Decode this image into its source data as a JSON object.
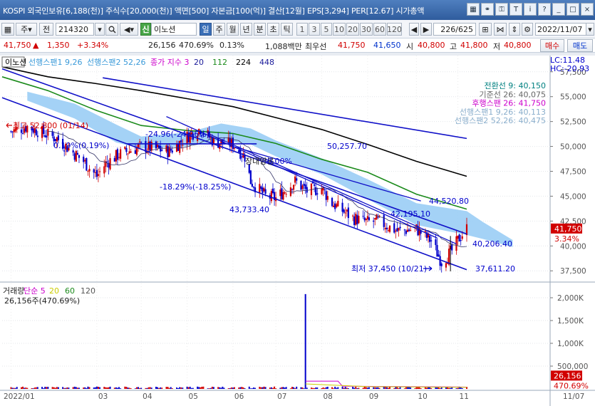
{
  "titlebar": {
    "ticker": "KOSPI 외국인보유[6,188(천)] 주식수[20,000(천)] 액면[500] 자본금[100(억)] 결산[12월] EPS[3,294] PER[12.67] 시가총액",
    "icons": [
      "grid-icon",
      "link-icon",
      "key-icon",
      "sticky-icon",
      "info-icon",
      "help-icon",
      "minimize-icon",
      "maximize-icon",
      "close-icon"
    ],
    "glyphs": [
      "▦",
      "⚭",
      "⚿",
      "T",
      "i",
      "?",
      "_",
      "□",
      "×"
    ]
  },
  "toolbar": {
    "market": "주",
    "market_arrow": "▾",
    "prev_label": "전",
    "code": "214320",
    "stock_name": "이노션",
    "stock_badge": "신",
    "periods": [
      "일",
      "주",
      "월",
      "년",
      "분",
      "초",
      "틱"
    ],
    "active_period": "일",
    "intervals": [
      "1",
      "3",
      "5",
      "10",
      "20",
      "30",
      "60",
      "120"
    ],
    "count": "226/625",
    "date": "2022/11/07"
  },
  "quote": {
    "price": "41,750",
    "arrow": "▲",
    "change": "1,350",
    "change_pct": "+3.34%",
    "volume": "26,156",
    "volume_ratio": "470.69%",
    "turnover": "0.13%",
    "amount": "1,088백만",
    "best_bid_label": "최우선",
    "best_ask": "41,750",
    "best_bid": "41,650",
    "open_label": "시",
    "open": "40,800",
    "high_label": "고",
    "high": "41,800",
    "low_label": "저",
    "low": "40,800",
    "buy_label": "매수",
    "sell_label": "매도"
  },
  "colors": {
    "up": "#d10000",
    "down": "#0000cc",
    "ma_black": "#000000",
    "ma_green": "#1a8a1a",
    "cloud": "#9fd0f5",
    "trend": "#1010c8"
  },
  "chart_data": [
    {
      "type": "line",
      "subtype": "candlestick",
      "legend": [
        {
          "name": "이노션",
          "color": "#000000"
        },
        {
          "name": "선행스팬1 9,26",
          "color": "#3a9ad9"
        },
        {
          "name": "선행스팬2 52,26",
          "color": "#3a9ad9"
        },
        {
          "name": "종가 지수 3",
          "color": "#cc00cc"
        },
        {
          "name": "20",
          "color": "#1a1a9a"
        },
        {
          "name": "112",
          "color": "#1a8a1a"
        },
        {
          "name": "224",
          "color": "#000000"
        },
        {
          "name": "448",
          "color": "#1a1a9a"
        }
      ],
      "ichimoku": [
        {
          "label": "전환선 9: 40,150",
          "color": "#008080"
        },
        {
          "label": "기준선 26: 40,075",
          "color": "#666666"
        },
        {
          "label": "후행스팬 26: 41,750",
          "color": "#cc00cc"
        },
        {
          "label": "선행스팬1 9,26: 40,113",
          "color": "#8aaecc"
        },
        {
          "label": "선행스팬2 52,26: 40,475",
          "color": "#8aaecc"
        }
      ],
      "lc_hc": [
        "LC:11.48",
        "HC:-20.93"
      ],
      "ylim": [
        36800,
        58200
      ],
      "y_ticks": [
        "57,500",
        "55,000",
        "52,500",
        "50,000",
        "47,500",
        "45,000",
        "42,500",
        "40,000",
        "37,500"
      ],
      "y_tick_values": [
        57500,
        55000,
        52500,
        50000,
        47500,
        45000,
        42500,
        40000,
        37500
      ],
      "current_price_label": "41,750",
      "current_pct_label": "3.34%",
      "x_labels": [
        "2022/01",
        "03",
        "04",
        "05",
        "06",
        "07",
        "08",
        "09",
        "10",
        "11"
      ],
      "x_dates": [
        "2022-01-03",
        "2022-03-02",
        "2022-04-01",
        "2022-05-02",
        "2022-06-02",
        "2022-07-01",
        "2022-08-01",
        "2022-09-01",
        "2022-10-04",
        "2022-11-01"
      ],
      "x_range": [
        "2021-12-28",
        "2022-11-07"
      ],
      "x_end_label": "11/07",
      "annotations": [
        {
          "text": "최고 52,800 (01/14)",
          "date": "2022-01-14",
          "value": 52800,
          "color": "#d10000"
        },
        {
          "text": "최저 37,450 (10/21)",
          "date": "2022-10-21",
          "value": 37450,
          "color": "#0000cc"
        },
        {
          "text": "50,257.70",
          "color": "#0000cc"
        },
        {
          "text": "44,520.80",
          "color": "#0000cc"
        },
        {
          "text": "42,195.10",
          "color": "#0000cc"
        },
        {
          "text": "40,206.40",
          "color": "#0000cc"
        },
        {
          "text": "43,733.40",
          "color": "#0000cc"
        },
        {
          "text": "37,611.20",
          "color": "#0000cc"
        },
        {
          "text": "-18.29%(-18.25%)",
          "color": "#0000cc"
        },
        {
          "text": "-24.96(-24.96%)",
          "color": "#0000cc"
        },
        {
          "text": "0.19%(0.19%)",
          "color": "#0000cc"
        },
        {
          "text": "장대양봉",
          "color": "#222222"
        },
        {
          "text": "0.00%",
          "color": "#0000cc"
        }
      ],
      "close_series": {
        "dates": [
          "2022-01-03",
          "2022-01-14",
          "2022-02-03",
          "2022-02-21",
          "2022-03-02",
          "2022-03-08",
          "2022-03-17",
          "2022-04-01",
          "2022-04-20",
          "2022-05-02",
          "2022-05-11",
          "2022-05-20",
          "2022-06-02",
          "2022-06-10",
          "2022-06-14",
          "2022-06-24",
          "2022-07-01",
          "2022-07-14",
          "2022-07-22",
          "2022-08-01",
          "2022-08-08",
          "2022-08-22",
          "2022-09-01",
          "2022-09-08",
          "2022-09-21",
          "2022-10-04",
          "2022-10-14",
          "2022-10-21",
          "2022-10-28",
          "2022-11-02",
          "2022-11-07"
        ],
        "values": [
          51500,
          52000,
          50800,
          48500,
          47000,
          48300,
          49200,
          50000,
          49500,
          51000,
          51800,
          50500,
          50200,
          49000,
          46500,
          45000,
          44800,
          46500,
          45500,
          45800,
          44300,
          42800,
          42400,
          42500,
          41500,
          41700,
          40500,
          38400,
          39500,
          40800,
          41750
        ]
      },
      "ma_224": {
        "dates": [
          "2021-12-28",
          "2022-01-28",
          "2022-03-02",
          "2022-04-01",
          "2022-05-02",
          "2022-06-02",
          "2022-07-01",
          "2022-08-01",
          "2022-09-01",
          "2022-10-04",
          "2022-11-07"
        ],
        "values": [
          58000,
          57000,
          56300,
          55600,
          54800,
          54000,
          52900,
          51700,
          50200,
          48500,
          47000
        ]
      },
      "ma_112": {
        "dates": [
          "2021-12-28",
          "2022-01-28",
          "2022-03-02",
          "2022-04-01",
          "2022-05-02",
          "2022-06-02",
          "2022-07-01",
          "2022-08-01",
          "2022-09-01",
          "2022-10-04",
          "2022-11-07"
        ],
        "values": [
          57000,
          55600,
          53600,
          52100,
          51600,
          51300,
          50300,
          48700,
          47400,
          45200,
          43700
        ]
      },
      "cloud_upper": {
        "dates": [
          "2022-01-14",
          "2022-02-15",
          "2022-03-15",
          "2022-04-01",
          "2022-05-02",
          "2022-05-25",
          "2022-06-14",
          "2022-07-01",
          "2022-08-01",
          "2022-09-01",
          "2022-10-04",
          "2022-11-07",
          "2022-11-18",
          "2022-12-08"
        ],
        "values": [
          55500,
          54300,
          52200,
          51000,
          51400,
          52300,
          51800,
          50600,
          48800,
          46700,
          44300,
          43500,
          42400,
          40600
        ]
      },
      "cloud_lower": {
        "dates": [
          "2022-01-14",
          "2022-02-15",
          "2022-03-15",
          "2022-04-01",
          "2022-05-02",
          "2022-05-25",
          "2022-06-14",
          "2022-07-01",
          "2022-08-01",
          "2022-09-01",
          "2022-10-04",
          "2022-11-07",
          "2022-11-18",
          "2022-12-08"
        ],
        "values": [
          54600,
          52800,
          50400,
          49800,
          50000,
          50600,
          50200,
          49000,
          47200,
          44700,
          42100,
          41100,
          40700,
          39900
        ]
      }
    },
    {
      "type": "bar",
      "legend": [
        {
          "name": "거래량",
          "color": "#222222"
        },
        {
          "name": "단순 5",
          "color": "#cc00cc"
        },
        {
          "name": "20",
          "color": "#cccc00"
        },
        {
          "name": "60",
          "color": "#1a8a1a"
        },
        {
          "name": "120",
          "color": "#555555"
        }
      ],
      "volume_note": "26,156주(470.69%)",
      "ylim": [
        0,
        2250000
      ],
      "y_ticks": [
        "2,000K",
        "1,500K",
        "1,000K",
        "500,000"
      ],
      "y_tick_values": [
        2000000,
        1500000,
        1000000,
        500000
      ],
      "current_label": "26,156",
      "current_pct_label": "470.69%",
      "spike": {
        "date": "2022-07-21",
        "value": 2080000
      },
      "typical_volume": 30000
    }
  ]
}
